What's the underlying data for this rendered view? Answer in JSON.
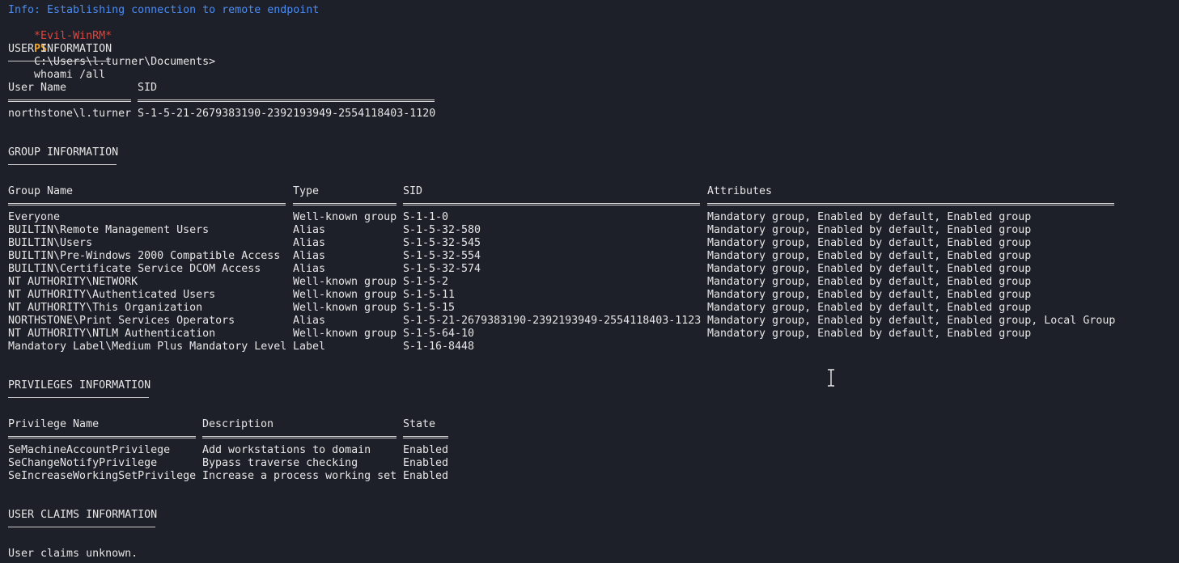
{
  "terminal": {
    "info_line": "Info: Establishing connection to remote endpoint",
    "prompt": {
      "name": "*Evil-WinRM*",
      "ps": "PS",
      "path": "C:\\Users\\l.turner\\Documents>",
      "command": "whoami /all"
    }
  },
  "user_info": {
    "heading": "USER INFORMATION",
    "headers": [
      "User Name",
      "SID"
    ],
    "row": [
      "northstone\\l.turner",
      "S-1-5-21-2679383190-2392193949-2554118403-1120"
    ]
  },
  "group_info": {
    "heading": "GROUP INFORMATION",
    "headers": [
      "Group Name",
      "Type",
      "SID",
      "Attributes"
    ],
    "rows": [
      [
        "Everyone",
        "Well-known group",
        "S-1-1-0",
        "Mandatory group, Enabled by default, Enabled group"
      ],
      [
        "BUILTIN\\Remote Management Users",
        "Alias",
        "S-1-5-32-580",
        "Mandatory group, Enabled by default, Enabled group"
      ],
      [
        "BUILTIN\\Users",
        "Alias",
        "S-1-5-32-545",
        "Mandatory group, Enabled by default, Enabled group"
      ],
      [
        "BUILTIN\\Pre-Windows 2000 Compatible Access",
        "Alias",
        "S-1-5-32-554",
        "Mandatory group, Enabled by default, Enabled group"
      ],
      [
        "BUILTIN\\Certificate Service DCOM Access",
        "Alias",
        "S-1-5-32-574",
        "Mandatory group, Enabled by default, Enabled group"
      ],
      [
        "NT AUTHORITY\\NETWORK",
        "Well-known group",
        "S-1-5-2",
        "Mandatory group, Enabled by default, Enabled group"
      ],
      [
        "NT AUTHORITY\\Authenticated Users",
        "Well-known group",
        "S-1-5-11",
        "Mandatory group, Enabled by default, Enabled group"
      ],
      [
        "NT AUTHORITY\\This Organization",
        "Well-known group",
        "S-1-5-15",
        "Mandatory group, Enabled by default, Enabled group"
      ],
      [
        "NORTHSTONE\\Print Services Operators",
        "Alias",
        "S-1-5-21-2679383190-2392193949-2554118403-1123",
        "Mandatory group, Enabled by default, Enabled group, Local Group"
      ],
      [
        "NT AUTHORITY\\NTLM Authentication",
        "Well-known group",
        "S-1-5-64-10",
        "Mandatory group, Enabled by default, Enabled group"
      ],
      [
        "Mandatory Label\\Medium Plus Mandatory Level",
        "Label",
        "S-1-16-8448",
        ""
      ]
    ]
  },
  "privileges_info": {
    "heading": "PRIVILEGES INFORMATION",
    "headers": [
      "Privilege Name",
      "Description",
      "State"
    ],
    "rows": [
      [
        "SeMachineAccountPrivilege",
        "Add workstations to domain",
        "Enabled"
      ],
      [
        "SeChangeNotifyPrivilege",
        "Bypass traverse checking",
        "Enabled"
      ],
      [
        "SeIncreaseWorkingSetPrivilege",
        "Increase a process working set",
        "Enabled"
      ]
    ]
  },
  "claims_info": {
    "heading": "USER CLAIMS INFORMATION",
    "text": "User claims unknown."
  },
  "icons": {
    "cursor": "text-cursor-icon"
  },
  "colors": {
    "background": "#1d1f29",
    "text": "#e6e6e6",
    "info": "#4b8cf0",
    "prompt_name": "#e0463c",
    "prompt_ps": "#f5a623"
  }
}
